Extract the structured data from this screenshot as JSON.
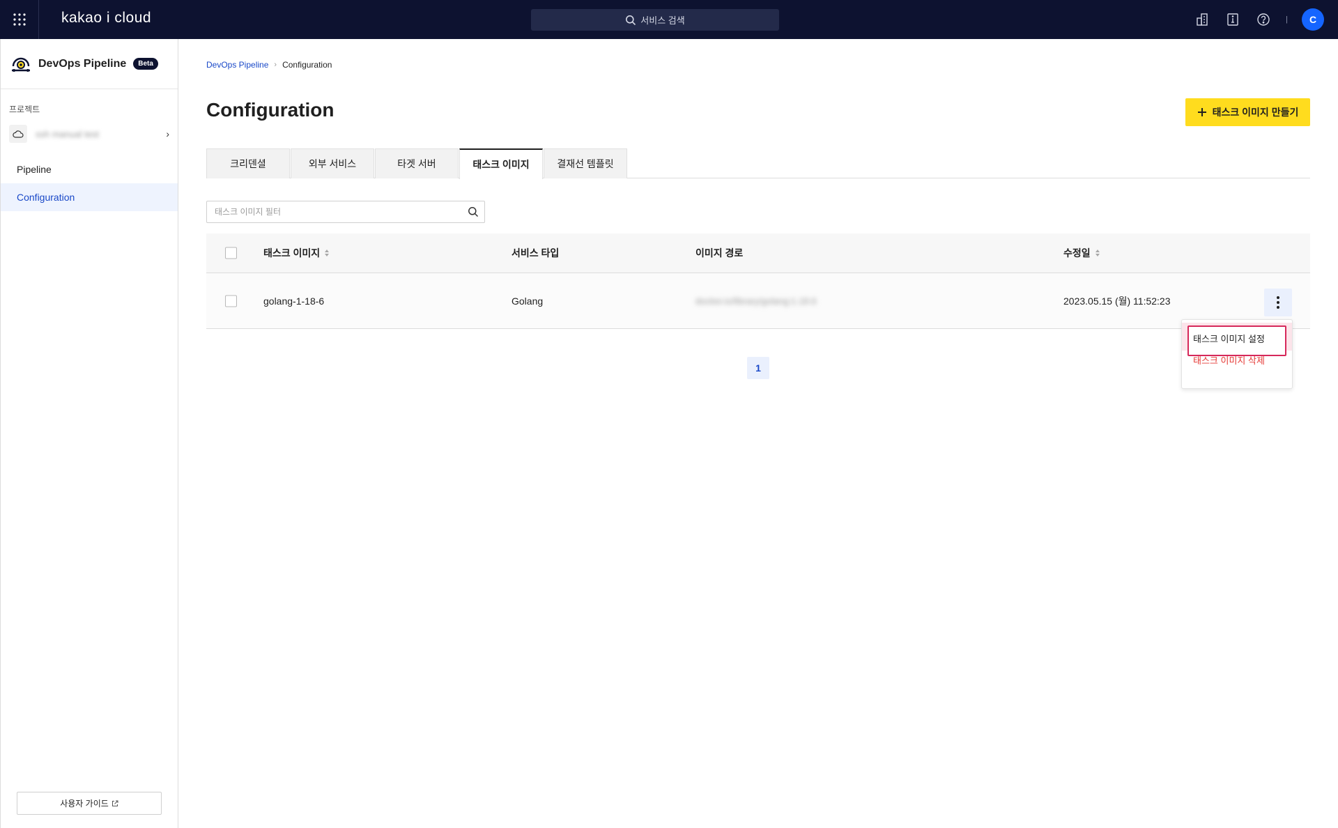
{
  "topbar": {
    "logo": "kakao i cloud",
    "search_label": "서비스 검색",
    "avatar_initial": "C",
    "separator": "|"
  },
  "sidebar": {
    "service_title": "DevOps Pipeline",
    "badge": "Beta",
    "project_section_label": "프로젝트",
    "project_name": "ssh manual test",
    "items": [
      {
        "label": "Pipeline",
        "active": false
      },
      {
        "label": "Configuration",
        "active": true
      }
    ],
    "guide_label": "사용자 가이드"
  },
  "breadcrumb": {
    "parent": "DevOps Pipeline",
    "current": "Configuration"
  },
  "page": {
    "title": "Configuration",
    "create_button_label": "태스크 이미지 만들기"
  },
  "tabs": [
    {
      "label": "크리덴셜",
      "active": false
    },
    {
      "label": "외부 서비스",
      "active": false
    },
    {
      "label": "타겟 서버",
      "active": false
    },
    {
      "label": "태스크 이미지",
      "active": true
    },
    {
      "label": "결재선 템플릿",
      "active": false
    }
  ],
  "filter": {
    "placeholder": "태스크 이미지 필터"
  },
  "table": {
    "columns": {
      "name": "태스크 이미지",
      "service_type": "서비스 타입",
      "image_path": "이미지 경로",
      "modified": "수정일"
    },
    "rows": [
      {
        "name": "golang-1-18-6",
        "service_type": "Golang",
        "image_path": "docker.io/library/golang:1.18.6",
        "modified": "2023.05.15 (월) 11:52:23"
      }
    ]
  },
  "row_menu": {
    "items": [
      "태스크 이미지 설정",
      "태스크 이미지 삭제"
    ]
  },
  "pagination": {
    "current": "1"
  },
  "colors": {
    "topbar": "#0d1230",
    "accent": "#1948c8",
    "create_button": "#ffdc1e",
    "danger": "#e53935",
    "highlight_border": "#d6285a"
  }
}
